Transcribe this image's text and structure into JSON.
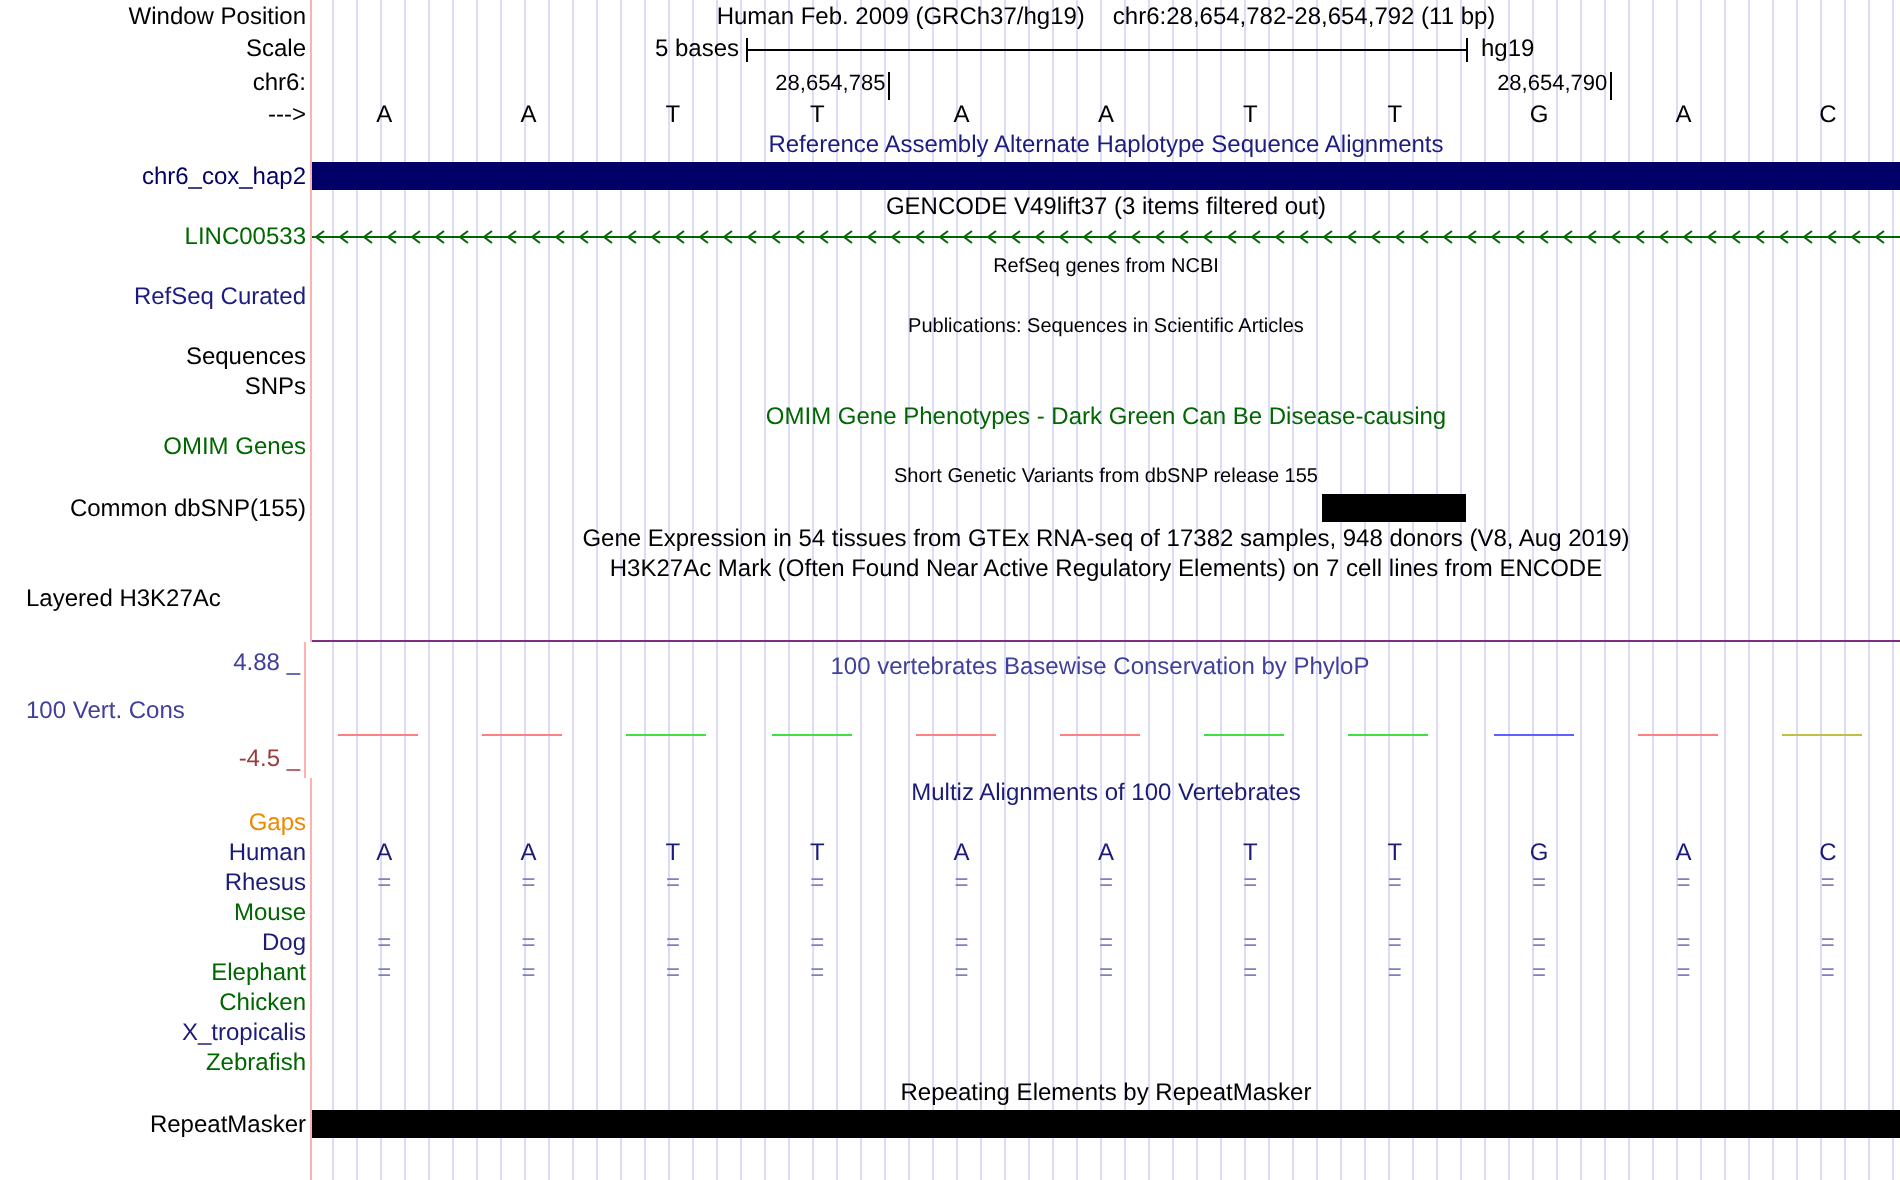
{
  "header": {
    "position_label": "Window Position",
    "assembly_text": "Human Feb. 2009 (GRCh37/hg19)",
    "range_text": "chr6:28,654,782-28,654,792 (11 bp)",
    "scale_label": "Scale",
    "scale_text": "5 bases",
    "db_text": "hg19",
    "chrom_label": "chr6:",
    "ticks": [
      "28,654,785",
      "28,654,790"
    ],
    "strand_label": "--->",
    "bases": [
      "A",
      "A",
      "T",
      "T",
      "A",
      "A",
      "T",
      "T",
      "G",
      "A",
      "C"
    ]
  },
  "tracks": [
    {
      "kind": "title",
      "text": "Reference Assembly Alternate Haplotype Sequence Alignments",
      "color": "#1c1c80"
    },
    {
      "kind": "bar",
      "label": "chr6_cox_hap2",
      "color": "#000066"
    },
    {
      "kind": "title",
      "text": "GENCODE V49lift37 (3 items filtered out)",
      "color": "#000000"
    },
    {
      "kind": "gene",
      "label": "LINC00533",
      "color": "#006600"
    },
    {
      "kind": "note",
      "text": "RefSeq genes from NCBI"
    },
    {
      "kind": "label",
      "label": "RefSeq Curated",
      "color": "#1c1c80"
    },
    {
      "kind": "note",
      "text": "Publications: Sequences in Scientific Articles"
    },
    {
      "kind": "label",
      "label": "Sequences",
      "color": "#000000"
    },
    {
      "kind": "label",
      "label": "SNPs",
      "color": "#000000"
    },
    {
      "kind": "title",
      "text": "OMIM Gene Phenotypes - Dark Green Can Be Disease-causing",
      "color": "#006600"
    },
    {
      "kind": "label",
      "label": "OMIM Genes",
      "color": "#006600"
    },
    {
      "kind": "note",
      "text": "Short Genetic Variants from dbSNP release 155"
    },
    {
      "kind": "snp",
      "label": "Common dbSNP(155)",
      "color": "#000000",
      "marked": [
        false,
        false,
        false,
        false,
        false,
        false,
        false,
        true,
        false,
        false,
        false
      ]
    },
    {
      "kind": "title",
      "text": "Gene Expression in 54 tissues from GTEx RNA-seq of 17382 samples, 948 donors (V8, Aug 2019)",
      "color": "#000000"
    },
    {
      "kind": "title",
      "text": "H3K27Ac Mark (Often Found Near Active Regulatory Elements) on 7 cell lines from ENCODE",
      "color": "#000000"
    },
    {
      "kind": "layered",
      "label": "Layered H3K27Ac",
      "color": "#000000",
      "line": {
        "color": "#7b2f82"
      }
    },
    {
      "kind": "wiggle",
      "title": "100 vertebrates Basewise Conservation by PhyloP",
      "label": "100 Vert. Cons",
      "color": "#40409a",
      "max": "4.88 _",
      "min": {
        "text": "-4.5 _",
        "color": "#9a3c3c"
      },
      "marks": [
        {
          "color": "#ff8080"
        },
        {
          "color": "#ff8080"
        },
        {
          "color": "#40e040"
        },
        {
          "color": "#40e040"
        },
        {
          "color": "#ff8080"
        },
        {
          "color": "#ff8080"
        },
        {
          "color": "#40e040"
        },
        {
          "color": "#40e040"
        },
        {
          "color": "#6060ff"
        },
        {
          "color": "#ff8080"
        },
        {
          "color": "#c0c040"
        }
      ]
    },
    {
      "kind": "title",
      "text": "Multiz Alignments of 100 Vertebrates",
      "color": "#1c1c78"
    },
    {
      "kind": "label",
      "label": "Gaps",
      "color": "#ee8800"
    },
    {
      "kind": "sequence",
      "label": "Human",
      "color": "#1c1c78",
      "cells": [
        "A",
        "A",
        "T",
        "T",
        "A",
        "A",
        "T",
        "T",
        "G",
        "A",
        "C"
      ]
    },
    {
      "kind": "match",
      "label": "Rhesus",
      "color": "#1c1c78",
      "cells": [
        "=",
        "=",
        "=",
        "=",
        "=",
        "=",
        "=",
        "=",
        "=",
        "=",
        "="
      ]
    },
    {
      "kind": "match",
      "label": "Mouse",
      "color": "#006600"
    },
    {
      "kind": "match",
      "label": "Dog",
      "color": "#1c1c78",
      "cells": [
        "=",
        "=",
        "=",
        "=",
        "=",
        "=",
        "=",
        "=",
        "=",
        "=",
        "="
      ]
    },
    {
      "kind": "match",
      "label": "Elephant",
      "color": "#006600",
      "cells": [
        "=",
        "=",
        "=",
        "=",
        "=",
        "=",
        "=",
        "=",
        "=",
        "=",
        "="
      ]
    },
    {
      "kind": "match",
      "label": "Chicken",
      "color": "#006600"
    },
    {
      "kind": "match",
      "label": "X_tropicalis",
      "color": "#1c1c78"
    },
    {
      "kind": "match",
      "label": "Zebrafish",
      "color": "#006600"
    },
    {
      "kind": "title",
      "text": "Repeating Elements by RepeatMasker",
      "color": "#000000"
    },
    {
      "kind": "bar",
      "label": "RepeatMasker",
      "color": "#000000"
    }
  ]
}
